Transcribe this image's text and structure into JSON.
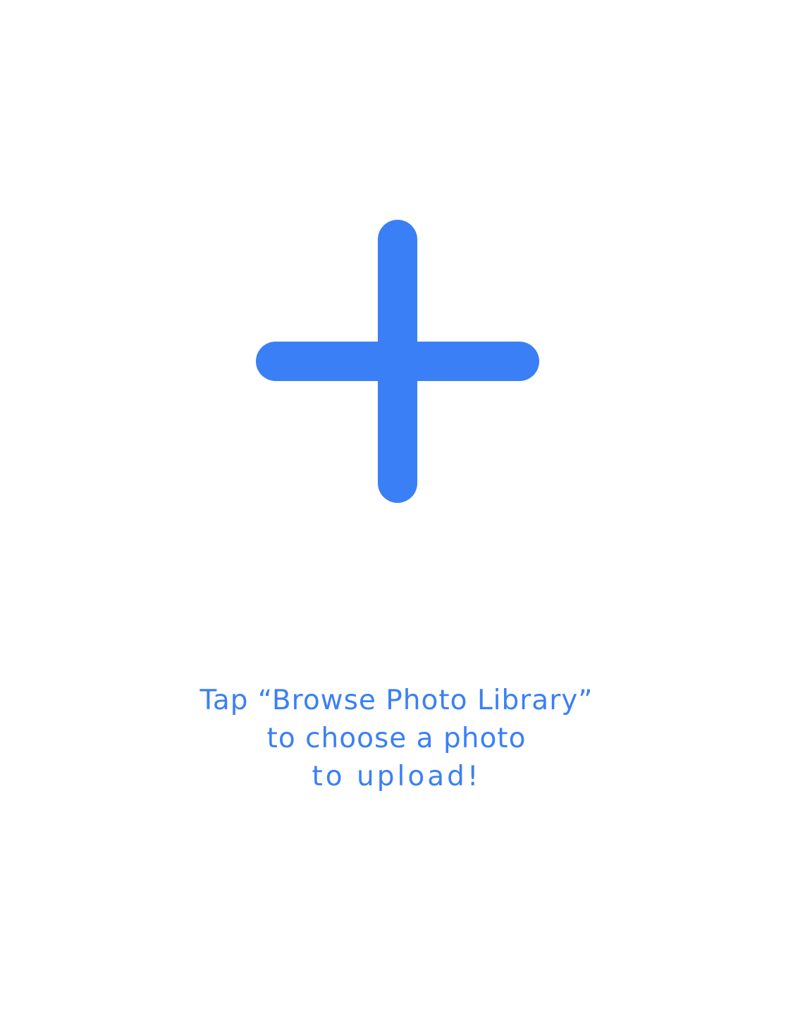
{
  "accent_color": "#3b7ff7",
  "background_color": "#ffffff",
  "icon": "plus-icon",
  "message": {
    "line1": "Tap “Browse Photo Library”",
    "line2": "to choose a photo",
    "line3": "to upload!"
  }
}
